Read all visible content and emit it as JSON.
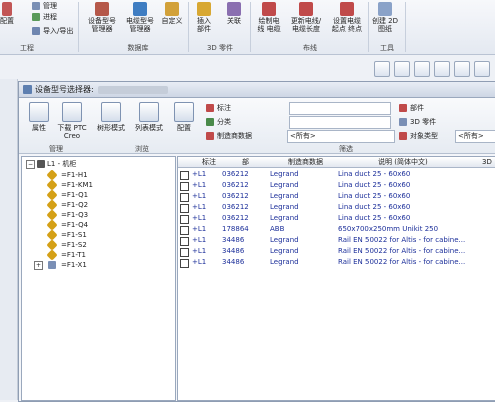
{
  "ribbon": {
    "left_items": [
      "配置"
    ],
    "small": [
      "管理",
      "进程",
      "导入/导出"
    ],
    "buttons": [
      {
        "label": "设备型号\n管理器"
      },
      {
        "label": "电缆型号\n管理器"
      },
      {
        "label": "自定义"
      },
      {
        "label": "插入\n部件"
      },
      {
        "label": "关联"
      },
      {
        "label": "绘制电\n线 电缆"
      },
      {
        "label": "更新电线/\n电缆长度"
      },
      {
        "label": "设置电缆\n起点 终点"
      },
      {
        "label": "创建 2D\n图纸"
      }
    ],
    "groups": [
      "工程",
      "数据库",
      "3D 零件",
      "布线",
      "工具"
    ]
  },
  "dialog": {
    "title": "设备型号选择器:",
    "buttons": [
      {
        "label": "属性"
      },
      {
        "label": "下载 PTC\nCreo"
      },
      {
        "label": "树形模式"
      },
      {
        "label": "列表模式"
      },
      {
        "label": "配置"
      }
    ],
    "group_labels": [
      "管理",
      "浏览",
      "筛选"
    ],
    "filters": {
      "tag_label": "标注",
      "class_label": "分类",
      "maker_label": "制造商数据",
      "maker_value": "<所有>",
      "part_label": "部件",
      "part3d_label": "3D 零件",
      "objtype_label": "对象类型",
      "objtype_value": "<所有>"
    },
    "tree": {
      "root": "L1 - 机柜",
      "items": [
        "=F1-H1",
        "=F1-KM1",
        "=F1-Q1",
        "=F1-Q2",
        "=F1-Q3",
        "=F1-Q4",
        "=F1-S1",
        "=F1-S2",
        "=F1-T1",
        "=F1-X1"
      ]
    },
    "table": {
      "headers": [
        "标注",
        "部",
        "制造商数据",
        "说明 (简体中文)",
        "3D"
      ],
      "rows": [
        {
          "tag": "+L1",
          "part": "036212",
          "maker": "Legrand",
          "desc": "Lina duct 25 - 60x60"
        },
        {
          "tag": "+L1",
          "part": "036212",
          "maker": "Legrand",
          "desc": "Lina duct 25 - 60x60"
        },
        {
          "tag": "+L1",
          "part": "036212",
          "maker": "Legrand",
          "desc": "Lina duct 25 - 60x60"
        },
        {
          "tag": "+L1",
          "part": "036212",
          "maker": "Legrand",
          "desc": "Lina duct 25 - 60x60"
        },
        {
          "tag": "+L1",
          "part": "036212",
          "maker": "Legrand",
          "desc": "Lina duct 25 - 60x60"
        },
        {
          "tag": "+L1",
          "part": "178864",
          "maker": "ABB",
          "desc": "650x700x250mm Unikit 250"
        },
        {
          "tag": "+L1",
          "part": "34486",
          "maker": "Legrand",
          "desc": "Rail EN 50022 for Altis - for cabine..."
        },
        {
          "tag": "+L1",
          "part": "34486",
          "maker": "Legrand",
          "desc": "Rail EN 50022 for Altis - for cabine..."
        },
        {
          "tag": "+L1",
          "part": "34486",
          "maker": "Legrand",
          "desc": "Rail EN 50022 for Altis - for cabine..."
        }
      ]
    }
  }
}
